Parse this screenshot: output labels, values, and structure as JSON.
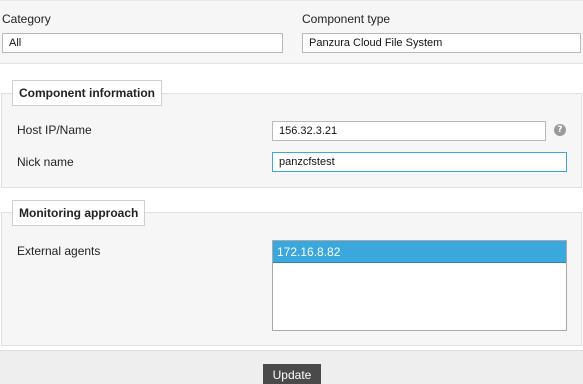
{
  "top": {
    "category_label": "Category",
    "category_value": "All",
    "component_type_label": "Component type",
    "component_type_value": "Panzura Cloud File System"
  },
  "component_information": {
    "legend": "Component information",
    "host_label": "Host IP/Name",
    "host_value": "156.32.3.21",
    "help_icon": "help-icon",
    "nick_label": "Nick name",
    "nick_value": "panzcfstest"
  },
  "monitoring_approach": {
    "legend": "Monitoring approach",
    "external_agents_label": "External agents",
    "agents": [
      {
        "label": "172.16.8.82",
        "selected": true
      }
    ]
  },
  "actions": {
    "update_label": "Update"
  },
  "colors": {
    "accent_selected": "#3aa7dd",
    "focus_border": "#3aa7dd",
    "button_bg": "#4a4a4a"
  }
}
